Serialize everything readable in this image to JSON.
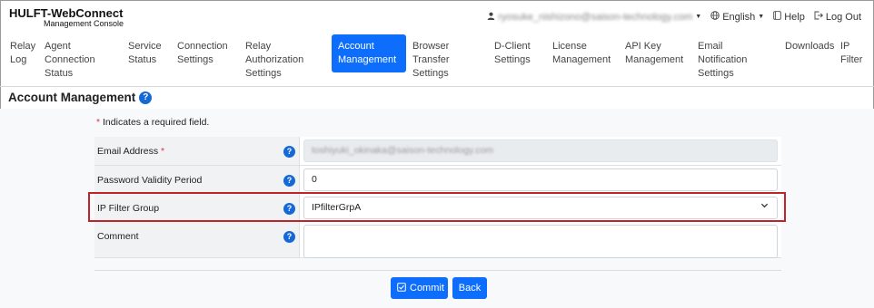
{
  "app": {
    "title": "HULFT-WebConnect",
    "subtitle": "Management Console"
  },
  "topbar": {
    "user_email": "ryosuke_nishizono@saison-technology.com",
    "language": "English",
    "help": "Help",
    "logout": "Log Out"
  },
  "nav": {
    "items": [
      {
        "label": "Relay Log"
      },
      {
        "label": "Agent Connection Status"
      },
      {
        "label": "Service Status"
      },
      {
        "label": "Connection Settings"
      },
      {
        "label": "Relay Authorization Settings"
      },
      {
        "label": "Account Management"
      },
      {
        "label": "Browser Transfer Settings"
      },
      {
        "label": "D-Client Settings"
      },
      {
        "label": "License Management"
      },
      {
        "label": "API Key Management"
      },
      {
        "label": "Email Notification Settings"
      },
      {
        "label": "Downloads"
      },
      {
        "label": "IP Filter"
      }
    ],
    "active": "Account Management"
  },
  "page": {
    "title": "Account Management",
    "required_note": "Indicates a required field."
  },
  "form": {
    "email_label": "Email Address",
    "email_value": "toshiyuki_okinaka@saison-technology.com",
    "password_label": "Password Validity Period",
    "password_value": "0",
    "ip_label": "IP Filter Group",
    "ip_value": "IPfilterGrpA",
    "comment_label": "Comment",
    "comment_value": ""
  },
  "buttons": {
    "commit": "Commit",
    "back": "Back"
  },
  "colors": {
    "accent": "#0d6efd",
    "highlight": "#c0232b",
    "required": "#dc3545"
  }
}
